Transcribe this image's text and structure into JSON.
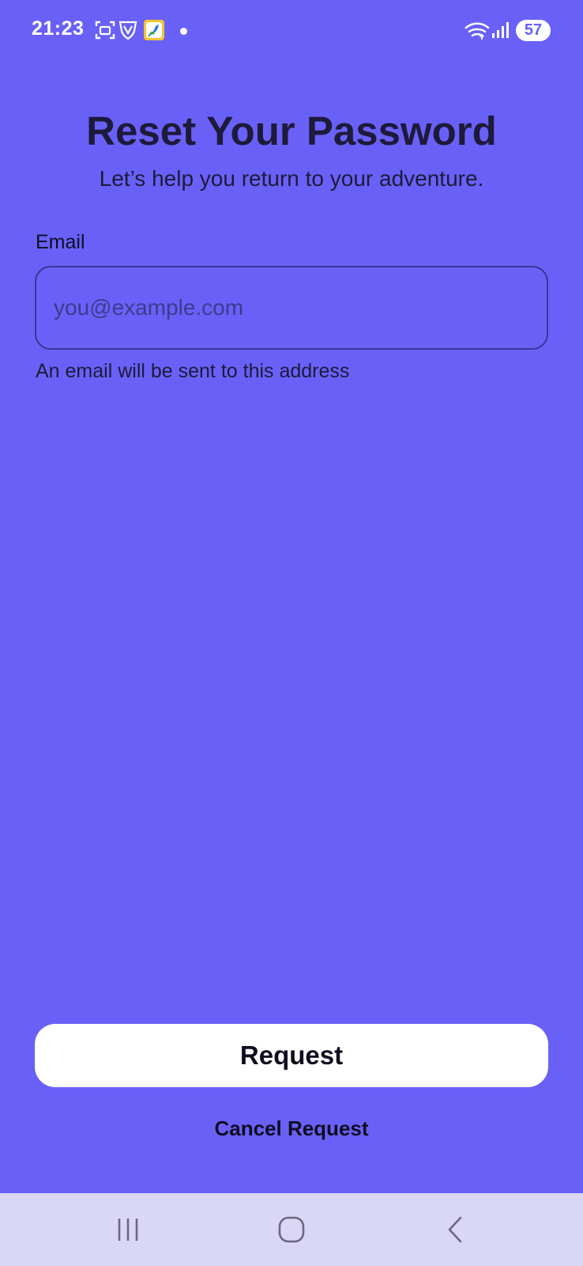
{
  "status_bar": {
    "time": "21:23",
    "battery": "57",
    "icons": [
      "screenshot-icon",
      "vpn-shield-icon",
      "app-notification-icon",
      "notification-dot",
      "wifi-icon",
      "signal-icon",
      "battery-icon"
    ]
  },
  "header": {
    "title": "Reset Your Password",
    "subtitle": "Let’s help you return to your adventure."
  },
  "form": {
    "email_label": "Email",
    "email_value": "",
    "email_placeholder": "you@example.com",
    "email_helper": "An email will be sent to this address"
  },
  "actions": {
    "request_label": "Request",
    "cancel_label": "Cancel Request"
  },
  "nav_bar": {
    "icons": [
      "recent-apps-icon",
      "home-icon",
      "back-icon"
    ]
  },
  "colors": {
    "background": "#6961F7",
    "text_dark": "#1E1A3A",
    "button_bg": "#FFFFFF",
    "nav_bar_bg": "#D9D6F6"
  }
}
